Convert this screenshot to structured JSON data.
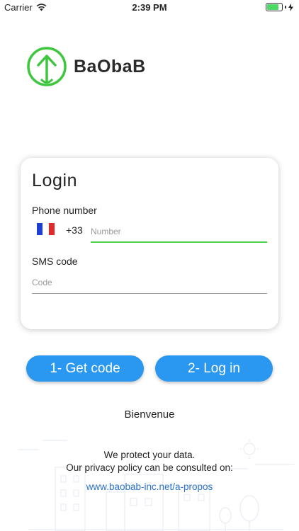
{
  "status_bar": {
    "carrier": "Carrier",
    "time": "2:39 PM",
    "battery_level": 0.9
  },
  "logo": {
    "text": "BaObaB"
  },
  "login": {
    "title": "Login",
    "phone_label": "Phone number",
    "country_flag": "france-flag",
    "dial_code": "+33",
    "number_placeholder": "Number",
    "number_value": "",
    "sms_label": "SMS code",
    "code_placeholder": "Code",
    "code_value": ""
  },
  "buttons": {
    "get_code": "1- Get code",
    "log_in": "2- Log in"
  },
  "welcome": "Bienvenue",
  "privacy": {
    "line1": "We protect your data.",
    "line2": "Our privacy policy can be consulted on:",
    "link": "www.baobab-inc.net/a-propos"
  },
  "colors": {
    "accent": "#2a97f0",
    "focus_underline": "#4cd04c",
    "logo_green": "#3ec63e",
    "link": "#2a72cc"
  }
}
